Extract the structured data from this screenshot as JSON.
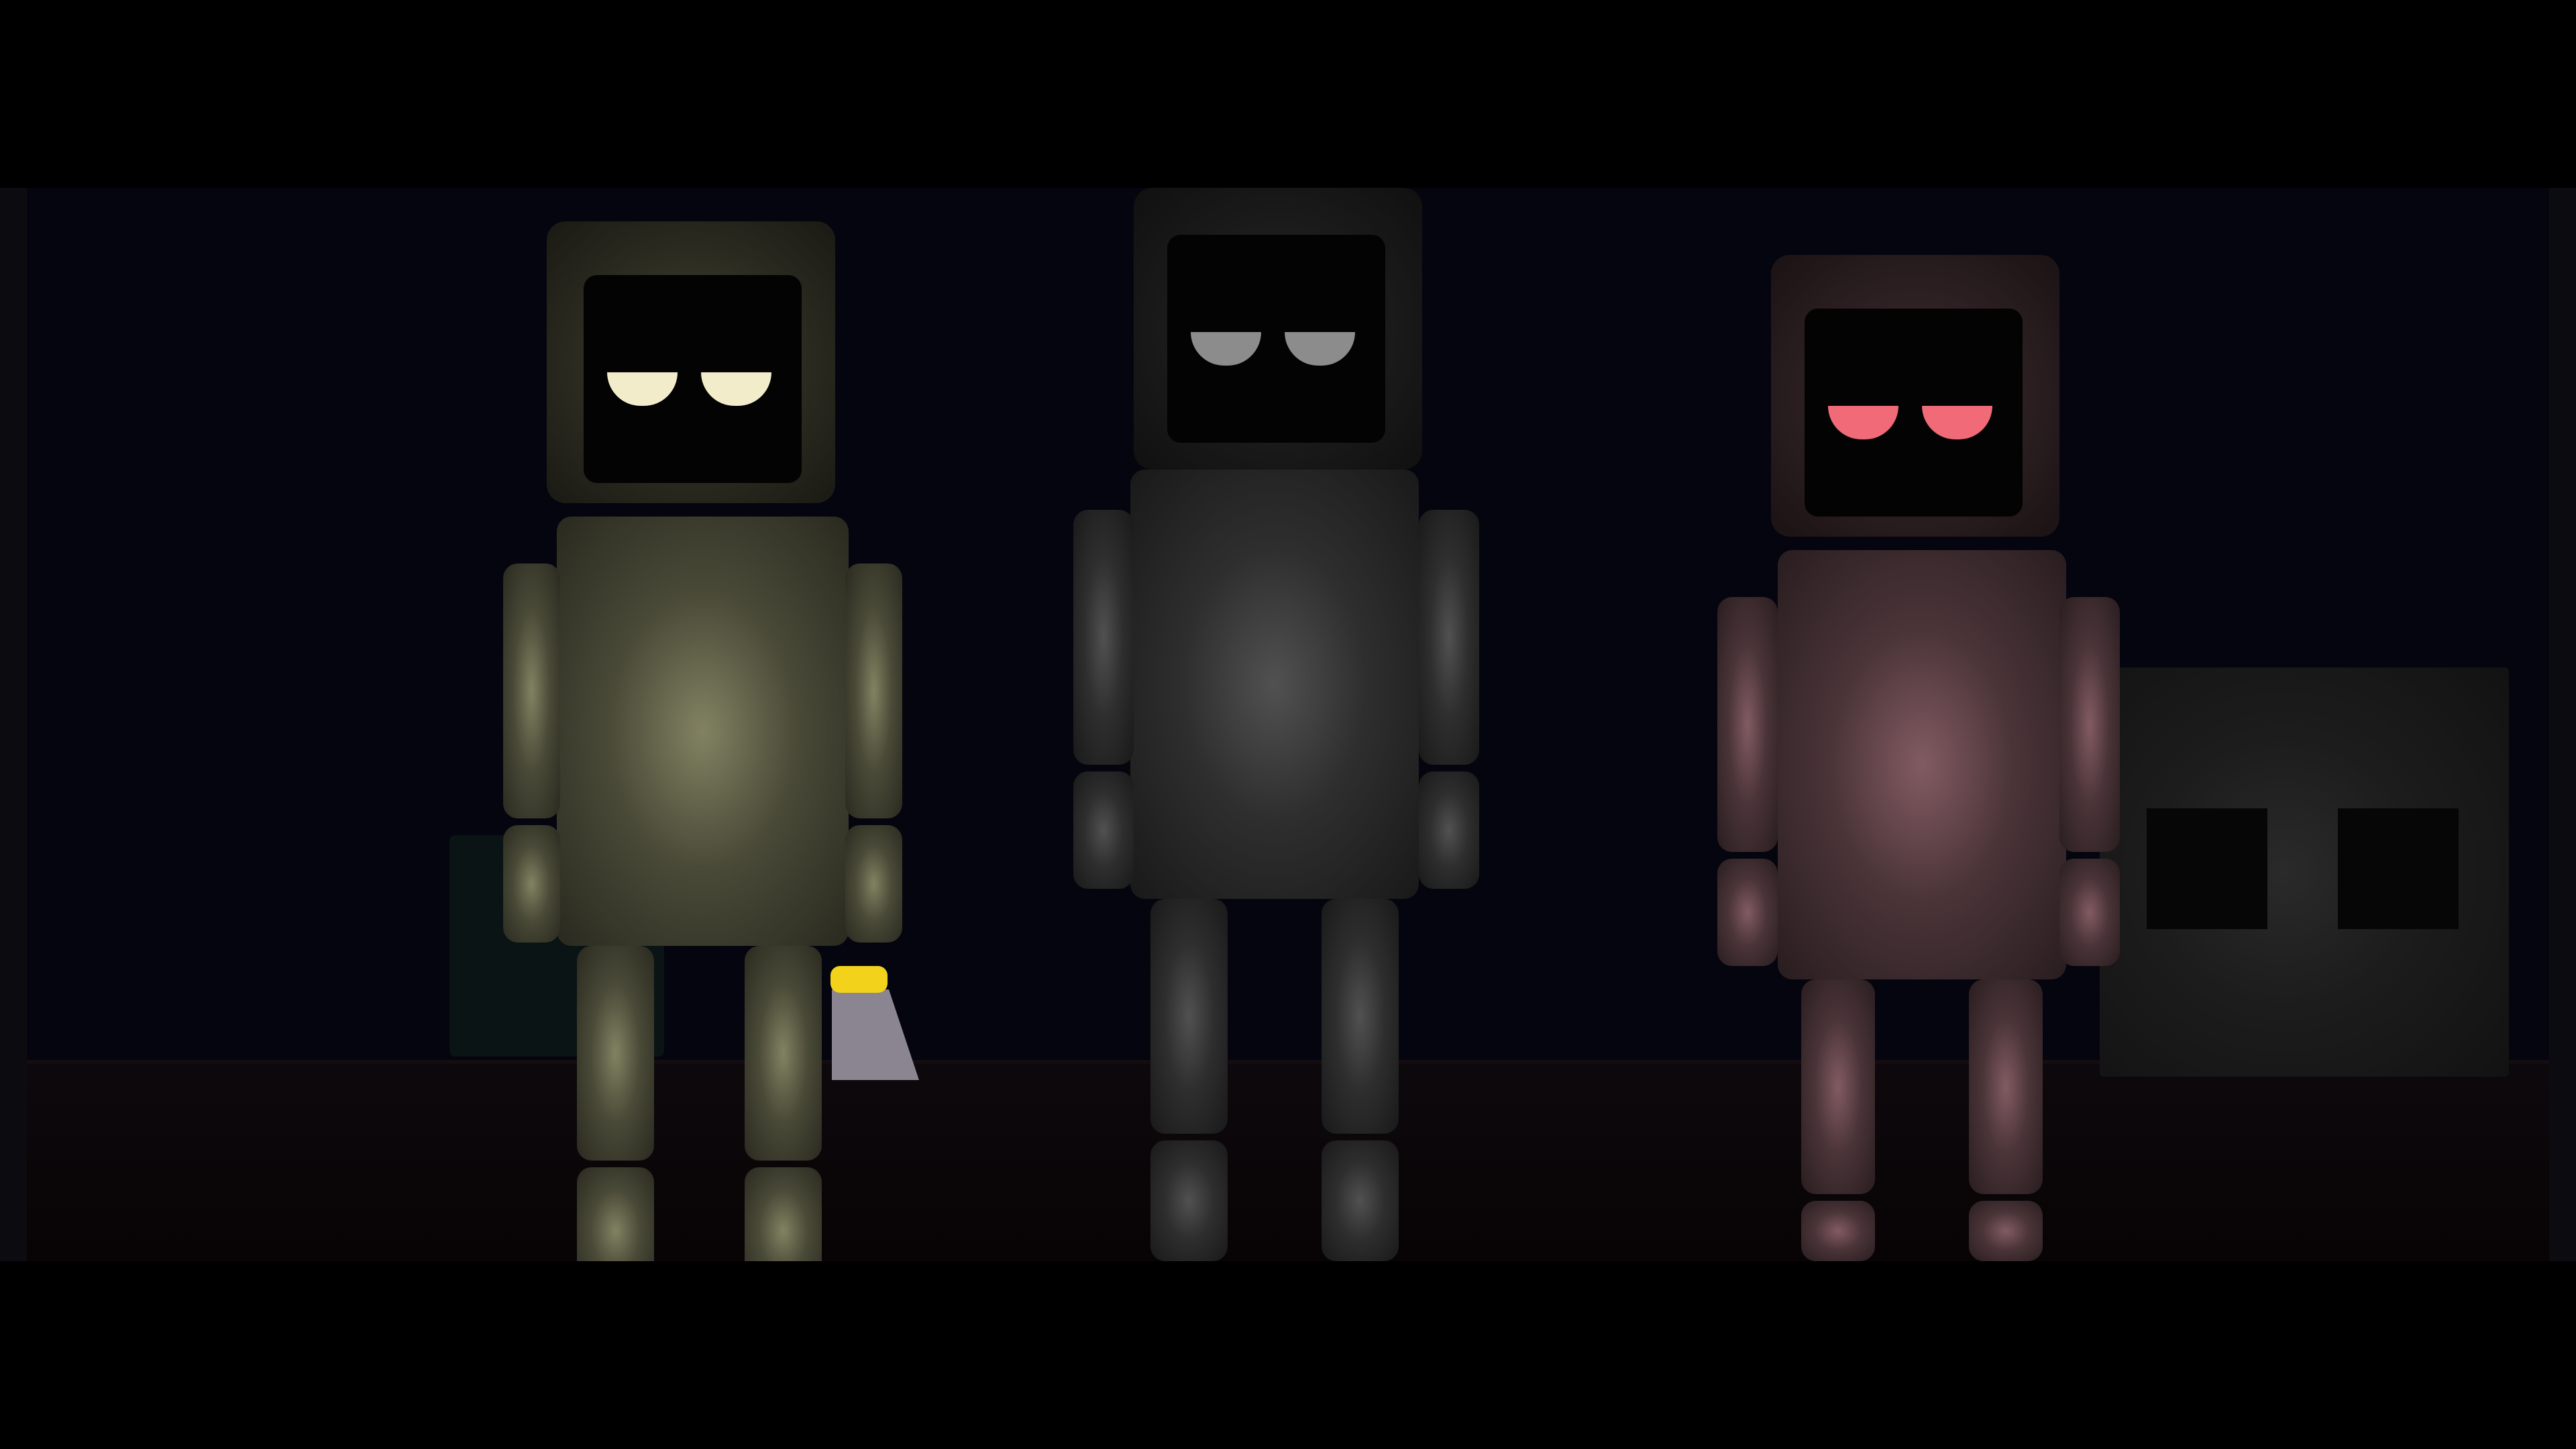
{
  "scene": {
    "background_color": "#05050f",
    "floor_color": "#0d080c"
  },
  "robots": [
    {
      "name": "left-robot",
      "body_color": "#4a4a38",
      "eye_color": "#f2eccb"
    },
    {
      "name": "middle-robot",
      "body_color": "#2e2e2e",
      "eye_color": "#8c8c8c"
    },
    {
      "name": "right-robot",
      "body_color": "#4a3438",
      "eye_color": "#f06a78"
    }
  ],
  "props": {
    "flashlight_tip_color": "#f2d21a",
    "flashlight_cone_color": "#8a8590",
    "crate_color": "#1c1c1c"
  }
}
